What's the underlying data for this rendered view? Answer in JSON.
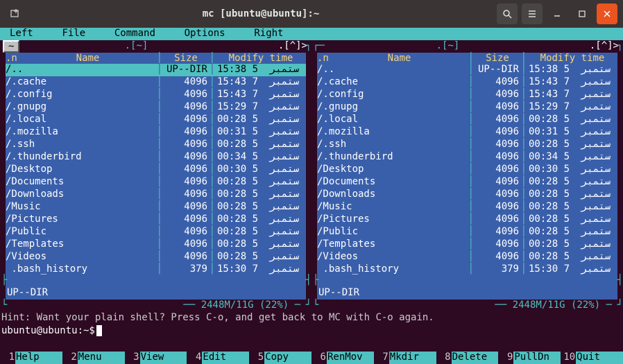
{
  "window": {
    "title": "mc [ubuntu@ubuntu]:~"
  },
  "menubar": {
    "items": [
      "Left",
      "File",
      "Command",
      "Options",
      "Right"
    ],
    "tilde_button": "~"
  },
  "panels": {
    "left": {
      "path": ".[~]",
      "caret": ".[^]>",
      "header": {
        "n": ".n",
        "name": "Name",
        "size": "Size",
        "mtime": "Modify time"
      },
      "rows": [
        {
          "name": "/..",
          "size": "UP--DIR",
          "mtime": "15:38 5  ستمبر",
          "selected": true
        },
        {
          "name": "/.cache",
          "size": "4096",
          "mtime": "15:43 7  ستمبر"
        },
        {
          "name": "/.config",
          "size": "4096",
          "mtime": "15:43 7  ستمبر"
        },
        {
          "name": "/.gnupg",
          "size": "4096",
          "mtime": "15:29 7  ستمبر"
        },
        {
          "name": "/.local",
          "size": "4096",
          "mtime": "00:28 5  ستمبر"
        },
        {
          "name": "/.mozilla",
          "size": "4096",
          "mtime": "00:31 5  ستمبر"
        },
        {
          "name": "/.ssh",
          "size": "4096",
          "mtime": "00:28 5  ستمبر"
        },
        {
          "name": "/.thunderbird",
          "size": "4096",
          "mtime": "00:34 5  ستمبر"
        },
        {
          "name": "/Desktop",
          "size": "4096",
          "mtime": "00:30 5  ستمبر"
        },
        {
          "name": "/Documents",
          "size": "4096",
          "mtime": "00:28 5  ستمبر"
        },
        {
          "name": "/Downloads",
          "size": "4096",
          "mtime": "00:28 5  ستمبر"
        },
        {
          "name": "/Music",
          "size": "4096",
          "mtime": "00:28 5  ستمبر"
        },
        {
          "name": "/Pictures",
          "size": "4096",
          "mtime": "00:28 5  ستمبر"
        },
        {
          "name": "/Public",
          "size": "4096",
          "mtime": "00:28 5  ستمبر"
        },
        {
          "name": "/Templates",
          "size": "4096",
          "mtime": "00:28 5  ستمبر"
        },
        {
          "name": "/Videos",
          "size": "4096",
          "mtime": "00:28 5  ستمبر"
        },
        {
          "name": " .bash_history",
          "size": "379",
          "mtime": "15:30 7  ستمبر"
        }
      ],
      "status": "UP--DIR",
      "disk": "2448M/11G (22%)"
    },
    "right": {
      "path": ".[~]",
      "caret": ".[^]>",
      "header": {
        "n": ".n",
        "name": "Name",
        "size": "Size",
        "mtime": "Modify time"
      },
      "rows": [
        {
          "name": "/..",
          "size": "UP--DIR",
          "mtime": "15:38 5  ستمبر"
        },
        {
          "name": "/.cache",
          "size": "4096",
          "mtime": "15:43 7  ستمبر"
        },
        {
          "name": "/.config",
          "size": "4096",
          "mtime": "15:43 7  ستمبر"
        },
        {
          "name": "/.gnupg",
          "size": "4096",
          "mtime": "15:29 7  ستمبر"
        },
        {
          "name": "/.local",
          "size": "4096",
          "mtime": "00:28 5  ستمبر"
        },
        {
          "name": "/.mozilla",
          "size": "4096",
          "mtime": "00:31 5  ستمبر"
        },
        {
          "name": "/.ssh",
          "size": "4096",
          "mtime": "00:28 5  ستمبر"
        },
        {
          "name": "/.thunderbird",
          "size": "4096",
          "mtime": "00:34 5  ستمبر"
        },
        {
          "name": "/Desktop",
          "size": "4096",
          "mtime": "00:30 5  ستمبر"
        },
        {
          "name": "/Documents",
          "size": "4096",
          "mtime": "00:28 5  ستمبر"
        },
        {
          "name": "/Downloads",
          "size": "4096",
          "mtime": "00:28 5  ستمبر"
        },
        {
          "name": "/Music",
          "size": "4096",
          "mtime": "00:28 5  ستمبر"
        },
        {
          "name": "/Pictures",
          "size": "4096",
          "mtime": "00:28 5  ستمبر"
        },
        {
          "name": "/Public",
          "size": "4096",
          "mtime": "00:28 5  ستمبر"
        },
        {
          "name": "/Templates",
          "size": "4096",
          "mtime": "00:28 5  ستمبر"
        },
        {
          "name": "/Videos",
          "size": "4096",
          "mtime": "00:28 5  ستمبر"
        },
        {
          "name": " .bash_history",
          "size": "379",
          "mtime": "15:30 7  ستمبر"
        }
      ],
      "status": "UP--DIR",
      "disk": "2448M/11G (22%)"
    }
  },
  "hint": "Hint: Want your plain shell? Press C-o, and get back to MC with C-o again.",
  "prompt": "ubuntu@ubuntu:~$",
  "fkeys": [
    {
      "n": "1",
      "label": "Help"
    },
    {
      "n": "2",
      "label": "Menu"
    },
    {
      "n": "3",
      "label": "View"
    },
    {
      "n": "4",
      "label": "Edit"
    },
    {
      "n": "5",
      "label": "Copy"
    },
    {
      "n": "6",
      "label": "RenMov"
    },
    {
      "n": "7",
      "label": "Mkdir"
    },
    {
      "n": "8",
      "label": "Delete"
    },
    {
      "n": "9",
      "label": "PullDn"
    },
    {
      "n": "10",
      "label": "Quit"
    }
  ]
}
